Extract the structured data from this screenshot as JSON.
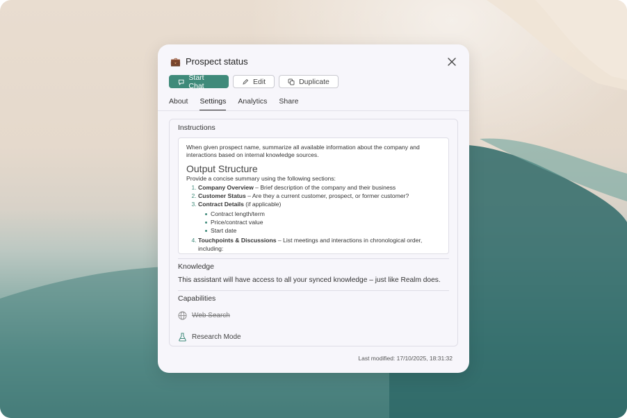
{
  "modal": {
    "title": "Prospect status",
    "emoji": "💼",
    "buttons": {
      "start_chat": "Start Chat",
      "edit": "Edit",
      "duplicate": "Duplicate"
    },
    "tabs": [
      "About",
      "Settings",
      "Analytics",
      "Share"
    ],
    "active_tab": "Settings",
    "instructions": {
      "label": "Instructions",
      "intro": "When given prospect name, summarize all available information about the company and interactions based on internal knowledge sources.",
      "heading": "Output Structure",
      "lead": "Provide a concise summary using the following sections:",
      "items": [
        {
          "bold": "Company Overview",
          "text": " – Brief description of the company and their business"
        },
        {
          "bold": "Customer Status",
          "text": " – Are they a current customer, prospect, or former customer?"
        },
        {
          "bold": "Contract Details",
          "text": " (if applicable)"
        },
        {
          "bold": "Touchpoints & Discussions",
          "text": " – List meetings and interactions in chronological order, including:"
        }
      ],
      "sub_items": [
        "Contract length/term",
        "Price/contract value",
        "Start date"
      ]
    },
    "knowledge": {
      "label": "Knowledge",
      "text": "This assistant will have access to all your synced knowledge – just like Realm does."
    },
    "capabilities": {
      "label": "Capabilities",
      "items": [
        {
          "label": "Web Search",
          "icon": "globe-icon",
          "enabled": false
        },
        {
          "label": "Research Mode",
          "icon": "flask-icon",
          "enabled": true
        }
      ]
    },
    "last_modified": "Last modified: 17/10/2025, 18:31:32"
  },
  "colors": {
    "accent": "#3f8a7a"
  }
}
